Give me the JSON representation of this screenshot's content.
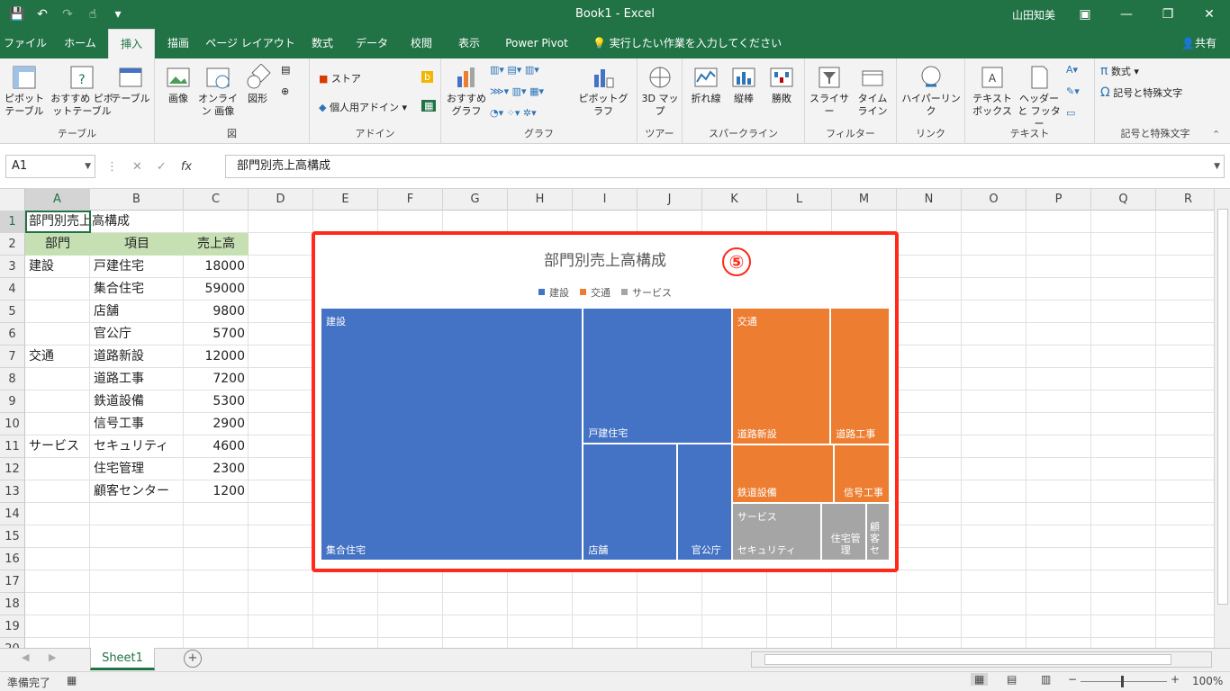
{
  "app": {
    "title": "Book1 - Excel",
    "user": "山田知美"
  },
  "tabs": [
    "ファイル",
    "ホーム",
    "挿入",
    "描画",
    "ページ レイアウト",
    "数式",
    "データ",
    "校閲",
    "表示",
    "Power Pivot"
  ],
  "tell_me": "実行したい作業を入力してください",
  "share": "共有",
  "ribbon": {
    "groups": {
      "table": "テーブル",
      "illust": "図",
      "addin": "アドイン",
      "chart": "グラフ",
      "tour": "ツアー",
      "spark": "スパークライン",
      "filter": "フィルター",
      "link": "リンク",
      "text": "テキスト",
      "symbol": "記号と特殊文字"
    },
    "btn": {
      "pivot": "ピボット テーブル",
      "recpivot": "おすすめ ピボットテーブル",
      "table": "テーブル",
      "picture": "画像",
      "online": "オンライン 画像",
      "shape": "図形",
      "store": "ストア",
      "myaddin": "個人用アドイン",
      "recchart": "おすすめ グラフ",
      "pivotchart": "ピボットグラフ",
      "map3d": "3D マップ",
      "line": "折れ線",
      "column": "縦棒",
      "winloss": "勝敗",
      "slicer": "スライサー",
      "timeline": "タイム ライン",
      "hyperlink": "ハイパーリンク",
      "textbox": "テキスト ボックス",
      "headerfooter": "ヘッダーと フッター",
      "equation": "数式",
      "symbol": "記号と特殊文字"
    }
  },
  "formula": {
    "namebox": "A1",
    "fx": "fx",
    "content": "部門別売上高構成"
  },
  "columns": [
    "A",
    "B",
    "C",
    "D",
    "E",
    "F",
    "G",
    "H",
    "I",
    "J",
    "K",
    "L",
    "M",
    "N",
    "O",
    "P",
    "Q",
    "R"
  ],
  "rows": [
    "1",
    "2",
    "3",
    "4",
    "5",
    "6",
    "7",
    "8",
    "9",
    "10",
    "11",
    "12",
    "13",
    "14",
    "15",
    "16",
    "17",
    "18",
    "19",
    "20"
  ],
  "sheet": {
    "a1": "部門別売上高構成",
    "headers": [
      "部門",
      "項目",
      "売上高"
    ],
    "data": [
      [
        "建設",
        "戸建住宅",
        "18000"
      ],
      [
        "",
        "集合住宅",
        "59000"
      ],
      [
        "",
        "店舗",
        "9800"
      ],
      [
        "",
        "官公庁",
        "5700"
      ],
      [
        "交通",
        "道路新設",
        "12000"
      ],
      [
        "",
        "道路工事",
        "7200"
      ],
      [
        "",
        "鉄道設備",
        "5300"
      ],
      [
        "",
        "信号工事",
        "2900"
      ],
      [
        "サービス",
        "セキュリティ",
        "4600"
      ],
      [
        "",
        "住宅管理",
        "2300"
      ],
      [
        "",
        "顧客センター",
        "1200"
      ]
    ]
  },
  "chart_data": {
    "type": "treemap",
    "title": "部門別売上高構成",
    "legend": [
      "建設",
      "交通",
      "サービス"
    ],
    "legend_position": "top",
    "colors": {
      "建設": "#4472c4",
      "交通": "#ed7d31",
      "サービス": "#a5a5a5"
    },
    "groups": [
      {
        "name": "建設",
        "items": [
          {
            "name": "集合住宅",
            "value": 59000
          },
          {
            "name": "戸建住宅",
            "value": 18000
          },
          {
            "name": "店舗",
            "value": 9800
          },
          {
            "name": "官公庁",
            "value": 5700
          }
        ]
      },
      {
        "name": "交通",
        "items": [
          {
            "name": "道路新設",
            "value": 12000
          },
          {
            "name": "道路工事",
            "value": 7200
          },
          {
            "name": "鉄道設備",
            "value": 5300
          },
          {
            "name": "信号工事",
            "value": 2900
          }
        ]
      },
      {
        "name": "サービス",
        "items": [
          {
            "name": "セキュリティ",
            "value": 4600
          },
          {
            "name": "住宅管理",
            "value": 2300
          },
          {
            "name": "顧客セ",
            "value": 1200
          }
        ]
      }
    ]
  },
  "annotation": "⑤",
  "sheet_tab": "Sheet1",
  "status": {
    "ready": "準備完了",
    "zoom": "100%"
  }
}
